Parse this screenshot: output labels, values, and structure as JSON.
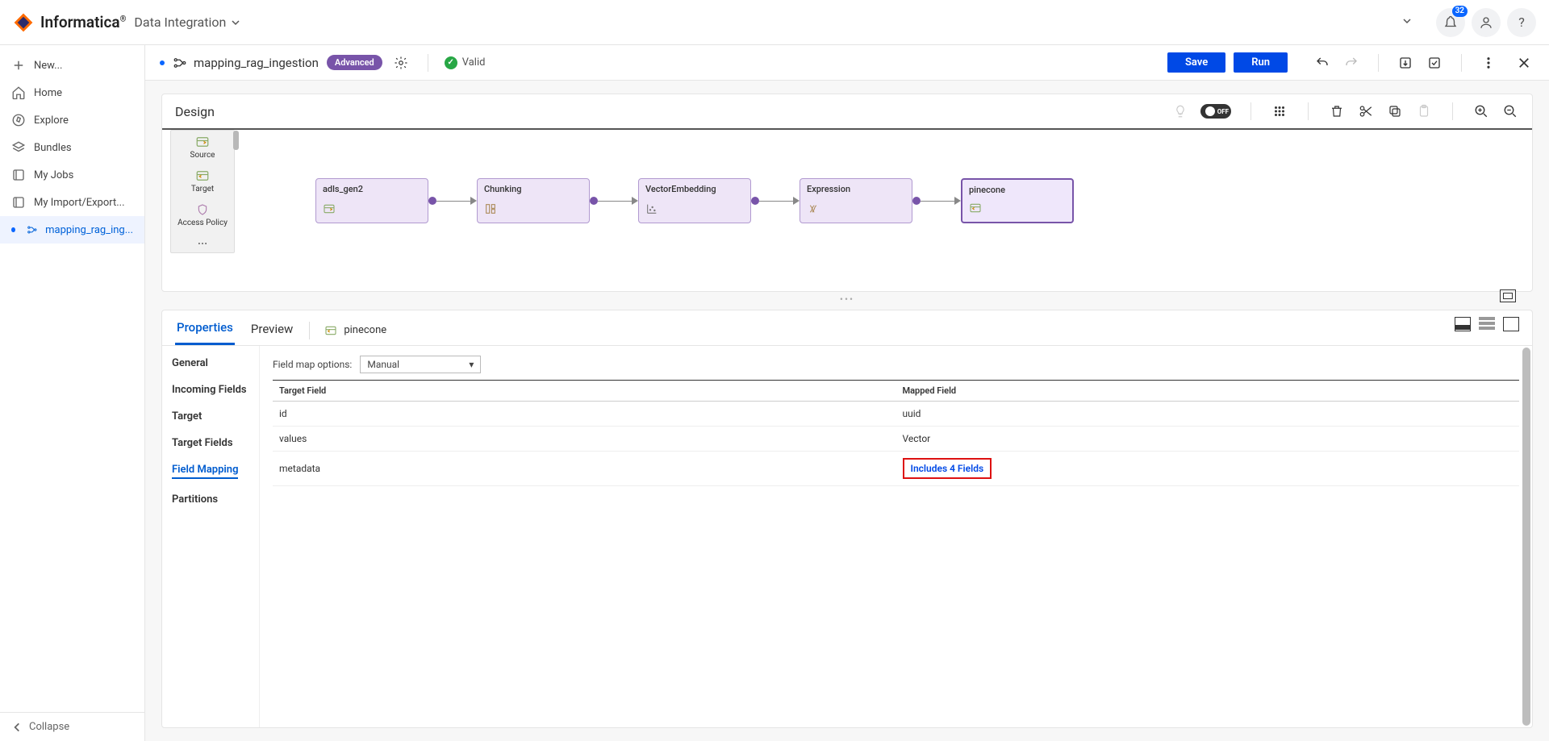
{
  "header": {
    "brand": "Informatica",
    "product": "Data Integration",
    "notify_count": "32"
  },
  "sidenav": {
    "new": "New...",
    "home": "Home",
    "explore": "Explore",
    "bundles": "Bundles",
    "myjobs": "My Jobs",
    "importexport": "My Import/Export...",
    "active_tab": "mapping_rag_ing...",
    "collapse": "Collapse"
  },
  "tabbar": {
    "title": "mapping_rag_ingestion",
    "badge": "Advanced",
    "valid": "Valid",
    "save": "Save",
    "run": "Run"
  },
  "design": {
    "title": "Design",
    "toggle": "OFF",
    "palette": {
      "source": "Source",
      "target": "Target",
      "access": "Access Policy"
    },
    "nodes": {
      "n1": "adls_gen2",
      "n2": "Chunking",
      "n3": "VectorEmbedding",
      "n4": "Expression",
      "n5": "pinecone"
    }
  },
  "props": {
    "tab_properties": "Properties",
    "tab_preview": "Preview",
    "crumb": "pinecone",
    "side": {
      "general": "General",
      "incoming": "Incoming Fields",
      "target": "Target",
      "target_fields": "Target Fields",
      "field_mapping": "Field Mapping",
      "partitions": "Partitions"
    },
    "fmopts_label": "Field map options:",
    "fmopts_value": "Manual",
    "cols": {
      "c1": "Target Field",
      "c2": "Mapped Field"
    },
    "rows": [
      {
        "tf": "id",
        "mf": "uuid"
      },
      {
        "tf": "values",
        "mf": "Vector"
      },
      {
        "tf": "metadata",
        "mf": "Includes 4 Fields"
      }
    ]
  }
}
